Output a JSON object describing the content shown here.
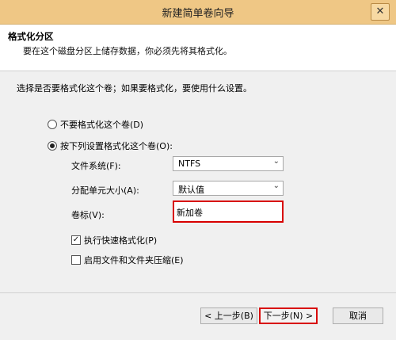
{
  "window": {
    "title": "新建简单卷向导",
    "close_glyph": "✕"
  },
  "header": {
    "title": "格式化分区",
    "subtitle": "要在这个磁盘分区上储存数据，你必须先将其格式化。"
  },
  "question": "选择是否要格式化这个卷；如果要格式化，要使用什么设置。",
  "options": {
    "no_format": {
      "label": "不要格式化这个卷(D)",
      "selected": false
    },
    "format": {
      "label": "按下列设置格式化这个卷(O):",
      "selected": true
    }
  },
  "settings": {
    "filesystem_label": "文件系统(F):",
    "filesystem_value": "NTFS",
    "alloc_label": "分配单元大小(A):",
    "alloc_value": "默认值",
    "volume_label_label": "卷标(V):",
    "volume_label_value": "新加卷"
  },
  "checkboxes": {
    "quick_format": {
      "label": "执行快速格式化(P)",
      "checked": true
    },
    "compression": {
      "label": "启用文件和文件夹压缩(E)",
      "checked": false
    }
  },
  "buttons": {
    "back": "< 上一步(B)",
    "next": "下一步(N) >",
    "cancel": "取消"
  },
  "icons": {
    "dropdown": "chevron-down-icon",
    "check": "checkmark-icon"
  },
  "colors": {
    "titlebar": "#efc785",
    "highlight": "#d80000"
  }
}
